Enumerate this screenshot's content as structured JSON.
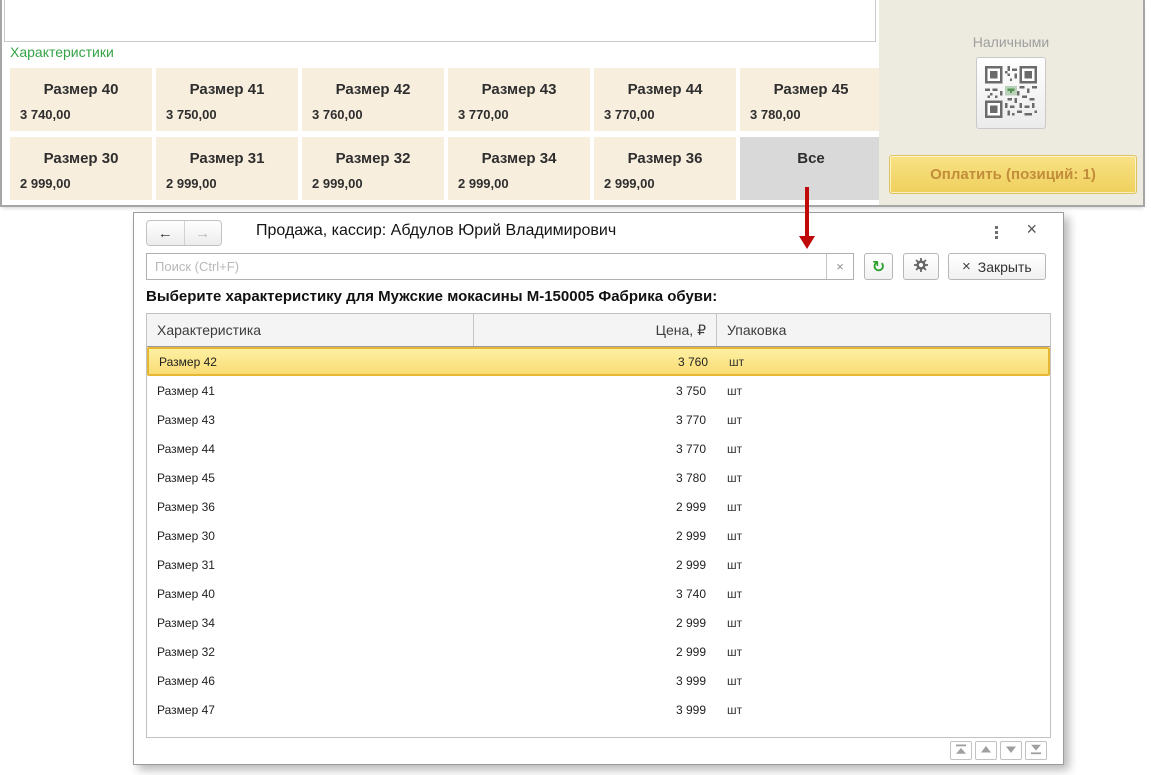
{
  "pos": {
    "characteristics_label": "Характеристики",
    "tiles": [
      {
        "label": "Размер 40",
        "price": "3 740,00"
      },
      {
        "label": "Размер 41",
        "price": "3 750,00"
      },
      {
        "label": "Размер 42",
        "price": "3 760,00"
      },
      {
        "label": "Размер 43",
        "price": "3 770,00"
      },
      {
        "label": "Размер 44",
        "price": "3 770,00"
      },
      {
        "label": "Размер 45",
        "price": "3 780,00"
      },
      {
        "label": "Размер 30",
        "price": "2 999,00"
      },
      {
        "label": "Размер 31",
        "price": "2 999,00"
      },
      {
        "label": "Размер 32",
        "price": "2 999,00"
      },
      {
        "label": "Размер 34",
        "price": "2 999,00"
      },
      {
        "label": "Размер 36",
        "price": "2 999,00"
      },
      {
        "label": "Все",
        "price": "",
        "all": true
      }
    ],
    "payment": {
      "method_label": "Наличными",
      "qr_icon": "qr-code-icon",
      "pay_button_label": "Оплатить (позиций: 1)"
    }
  },
  "dialog": {
    "title": "Продажа, кассир: Абдулов Юрий Владимирович",
    "back_icon": "←",
    "forward_icon": "→",
    "menu_icon": "vertical-dots",
    "close_icon": "×",
    "search": {
      "placeholder": "Поиск (Ctrl+F)",
      "clear_icon": "×",
      "refresh_icon": "↻",
      "settings_icon": "gear"
    },
    "close_button_label": "Закрыть",
    "heading": "Выберите характеристику для Мужские мокасины М-150005 Фабрика обуви:",
    "table": {
      "columns": [
        "Характеристика",
        "Цена, ₽",
        "Упаковка"
      ],
      "rows": [
        {
          "name": "Размер 42",
          "price": "3 760",
          "pack": "шт",
          "selected": true
        },
        {
          "name": "Размер 41",
          "price": "3 750",
          "pack": "шт"
        },
        {
          "name": "Размер 43",
          "price": "3 770",
          "pack": "шт"
        },
        {
          "name": "Размер 44",
          "price": "3 770",
          "pack": "шт"
        },
        {
          "name": "Размер 45",
          "price": "3 780",
          "pack": "шт"
        },
        {
          "name": "Размер 36",
          "price": "2 999",
          "pack": "шт"
        },
        {
          "name": "Размер 30",
          "price": "2 999",
          "pack": "шт"
        },
        {
          "name": "Размер 31",
          "price": "2 999",
          "pack": "шт"
        },
        {
          "name": "Размер 40",
          "price": "3 740",
          "pack": "шт"
        },
        {
          "name": "Размер 34",
          "price": "2 999",
          "pack": "шт"
        },
        {
          "name": "Размер 32",
          "price": "2 999",
          "pack": "шт"
        },
        {
          "name": "Размер 46",
          "price": "3 999",
          "pack": "шт"
        },
        {
          "name": "Размер 47",
          "price": "3 999",
          "pack": "шт"
        }
      ]
    },
    "scroll_buttons": [
      "scroll-to-top",
      "scroll-up",
      "scroll-down",
      "scroll-to-bottom"
    ]
  },
  "colors": {
    "characteristics_green": "#36a446",
    "tile_bg": "#f8eede",
    "all_tile_bg": "#d9d9d9",
    "panel_beige": "#edeadf",
    "pay_button_yellow": "#f3d96b",
    "pay_button_text": "#c28d3a",
    "selected_row_yellow": "#fbe283",
    "selected_row_border": "#e5b733",
    "arrow_red": "#c00a0a",
    "refresh_green": "#2da12d"
  }
}
